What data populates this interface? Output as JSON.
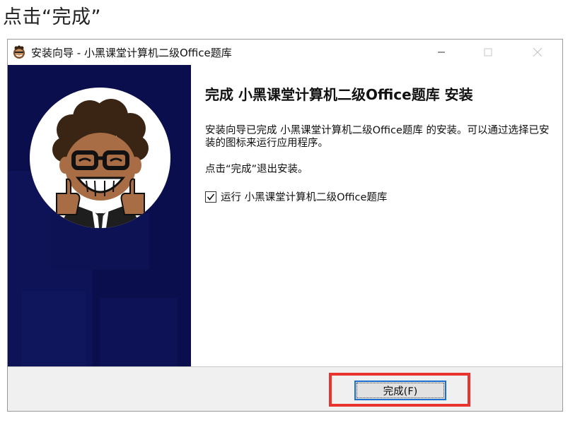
{
  "caption": "点击“完成”",
  "window": {
    "title": "安装向导 - 小黑课堂计算机二级Office题库",
    "heading": "完成 小黑课堂计算机二级Office题库 安装",
    "paragraph1": "安装向导已完成 小黑课堂计算机二级Office题库 的安装。可以通过选择已安装的图标来运行应用程序。",
    "paragraph2": "点击“完成”退出安装。",
    "run_checkbox": {
      "label": "运行 小黑课堂计算机二级Office题库",
      "checked": true
    },
    "finish_button_label": "完成(F)"
  },
  "icons": [
    "app-icon",
    "minimize-icon",
    "maximize-icon",
    "close-icon",
    "checkmark-icon",
    "cartoon-avatar"
  ],
  "colors": {
    "side_panel": "#0a0e4c",
    "highlight": "#e8332f",
    "button_focus": "#1a6fd0"
  }
}
